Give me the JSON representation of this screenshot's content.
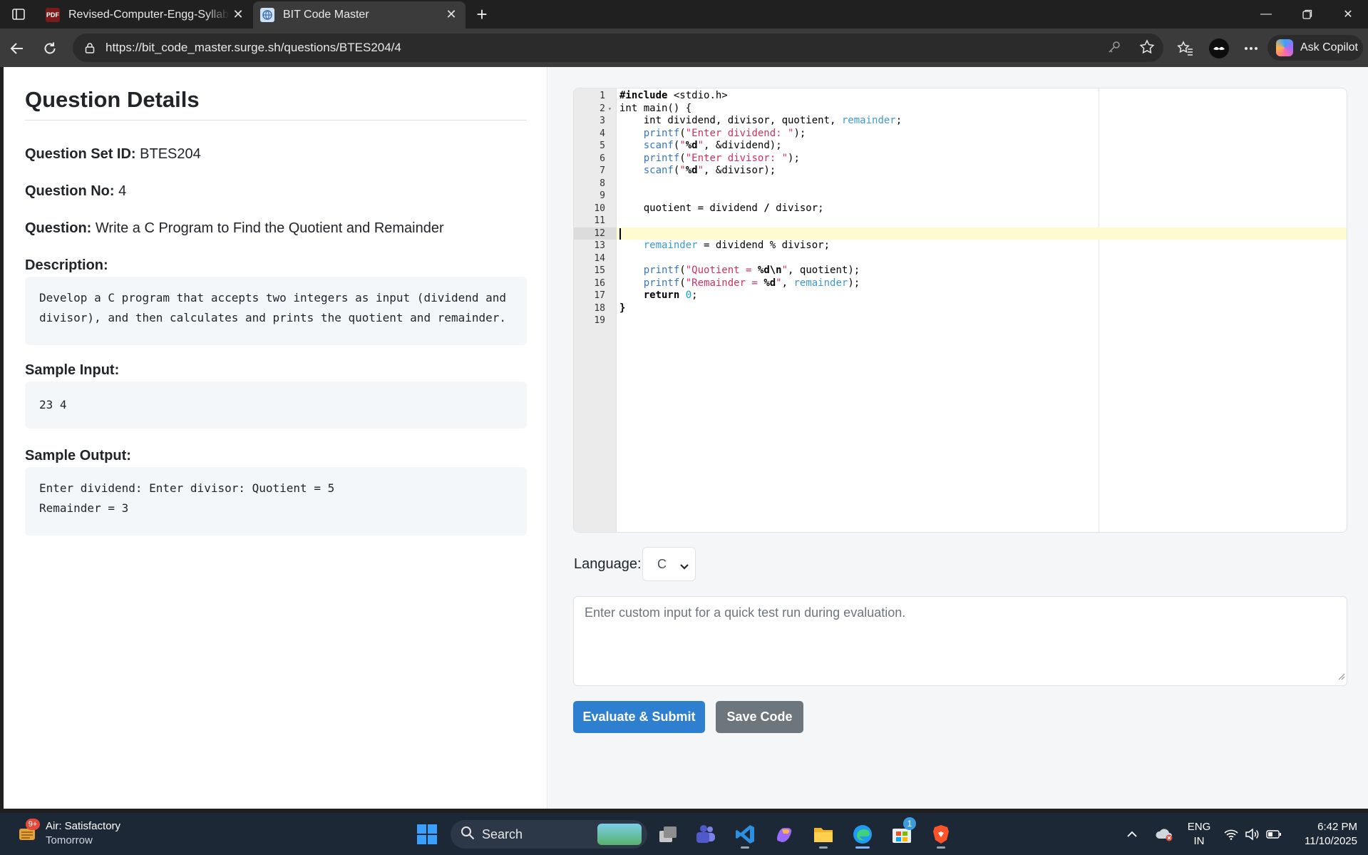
{
  "browser": {
    "tabs": [
      {
        "title": "Revised-Computer-Engg-Syllabus",
        "favicon": "pdf-icon"
      },
      {
        "title": "BIT Code Master",
        "favicon": "site-icon"
      }
    ],
    "url": "https://bit_code_master.surge.sh/questions/BTES204/4",
    "copilot_label": "Ask Copilot"
  },
  "question": {
    "heading": "Question Details",
    "set_id_label": "Question Set ID:",
    "set_id": "BTES204",
    "number_label": "Question No:",
    "number": "4",
    "question_label": "Question:",
    "question_text": "Write a C Program to Find the Quotient and Remainder",
    "description_label": "Description:",
    "description": "Develop a C program that accepts two integers as input (dividend and divisor), and then calculates and prints the quotient and remainder.",
    "sample_input_label": "Sample Input:",
    "sample_input": "23 4",
    "sample_output_label": "Sample Output:",
    "sample_output_lines": [
      "Enter dividend: Enter divisor: Quotient = 5",
      "Remainder = 3"
    ]
  },
  "editor": {
    "active_line": 12,
    "lines": [
      [
        [
          "kw",
          "#include"
        ],
        [
          "txt",
          " <stdio.h>"
        ]
      ],
      [
        [
          "txt",
          "int main() {"
        ]
      ],
      [
        [
          "txt",
          "    int dividend, divisor, quotient, "
        ],
        [
          "var",
          "remainder"
        ],
        [
          "txt",
          ";"
        ]
      ],
      [
        [
          "txt",
          "    "
        ],
        [
          "fn",
          "printf"
        ],
        [
          "txt",
          "("
        ],
        [
          "str",
          "\"Enter dividend: \""
        ],
        [
          "txt",
          ");"
        ]
      ],
      [
        [
          "txt",
          "    "
        ],
        [
          "fn",
          "scanf"
        ],
        [
          "txt",
          "("
        ],
        [
          "str",
          "\""
        ],
        [
          "kw",
          "%d"
        ],
        [
          "str",
          "\""
        ],
        [
          "txt",
          ", &dividend);"
        ]
      ],
      [
        [
          "txt",
          "    "
        ],
        [
          "fn",
          "printf"
        ],
        [
          "txt",
          "("
        ],
        [
          "str",
          "\"Enter divisor: \""
        ],
        [
          "txt",
          ");"
        ]
      ],
      [
        [
          "txt",
          "    "
        ],
        [
          "fn",
          "scanf"
        ],
        [
          "txt",
          "("
        ],
        [
          "str",
          "\""
        ],
        [
          "kw",
          "%d"
        ],
        [
          "str",
          "\""
        ],
        [
          "txt",
          ", &divisor);"
        ]
      ],
      [],
      [],
      [
        [
          "txt",
          "    quotient = dividend "
        ],
        [
          "kw",
          "/"
        ],
        [
          "txt",
          " divisor;"
        ]
      ],
      [],
      [],
      [
        [
          "txt",
          "    "
        ],
        [
          "var",
          "remainder"
        ],
        [
          "txt",
          " = dividend % divisor;"
        ]
      ],
      [],
      [
        [
          "txt",
          "    "
        ],
        [
          "fn",
          "printf"
        ],
        [
          "txt",
          "("
        ],
        [
          "str",
          "\"Quotient = "
        ],
        [
          "kw",
          "%d\\n"
        ],
        [
          "str",
          "\""
        ],
        [
          "txt",
          ", quotient);"
        ]
      ],
      [
        [
          "txt",
          "    "
        ],
        [
          "fn",
          "printf"
        ],
        [
          "txt",
          "("
        ],
        [
          "str",
          "\"Remainder = "
        ],
        [
          "kw",
          "%d"
        ],
        [
          "str",
          "\""
        ],
        [
          "txt",
          ", "
        ],
        [
          "var",
          "remainder"
        ],
        [
          "txt",
          ");"
        ]
      ],
      [
        [
          "txt",
          "    "
        ],
        [
          "kw",
          "return"
        ],
        [
          "txt",
          " "
        ],
        [
          "num",
          "0"
        ],
        [
          "txt",
          ";"
        ]
      ],
      [
        [
          "kw",
          "}"
        ]
      ],
      []
    ]
  },
  "controls": {
    "language_label": "Language:",
    "language_value": "C",
    "custom_input_placeholder": "Enter custom input for a quick test run during evaluation.",
    "submit_label": "Evaluate & Submit",
    "save_label": "Save Code"
  },
  "taskbar": {
    "weather_title": "Air: Satisfactory",
    "weather_sub": "Tomorrow",
    "weather_badge": "9+",
    "search_label": "Search",
    "store_badge": "1",
    "lang_line1": "ENG",
    "lang_line2": "IN",
    "time": "6:42 PM",
    "date": "11/10/2025"
  },
  "colors": {
    "primary": "#2f7fd1",
    "secondary": "#6d757d",
    "active_line": "#fffbd1"
  }
}
